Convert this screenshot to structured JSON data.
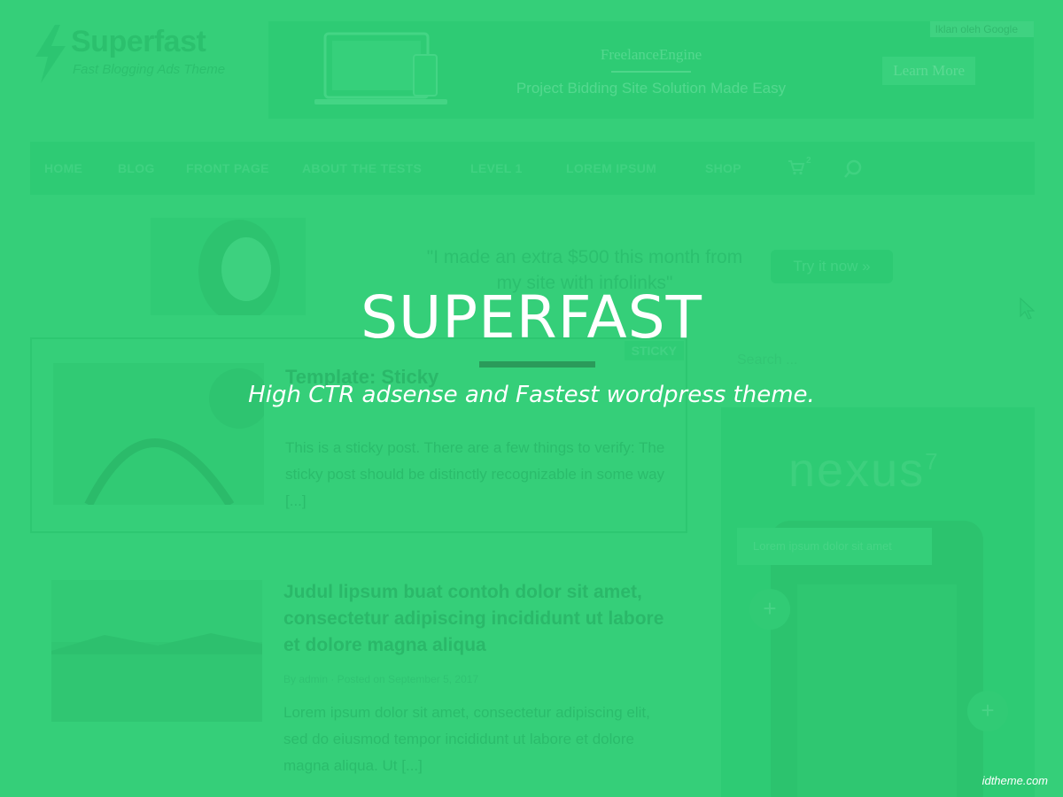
{
  "header": {
    "logo_title": "Superfast",
    "logo_tagline": "Fast Blogging Ads Theme",
    "ad_banner": {
      "label": "Iklan oleh Google",
      "brand": "FreelanceEngine",
      "description": "Project Bidding Site Solution Made Easy",
      "cta": "Learn More"
    }
  },
  "nav": {
    "items": [
      "HOME",
      "BLOG",
      "FRONT PAGE",
      "ABOUT THE TESTS",
      "LEVEL 1",
      "LOREM IPSUM",
      "SHOP"
    ],
    "cart_count": "2"
  },
  "promo": {
    "text": "\"I made an extra $500 this month from my site with infolinks\"",
    "button": "Try it now »"
  },
  "posts": [
    {
      "title": "Template: Sticky",
      "badge": "STICKY",
      "excerpt": "This is a sticky post. There are a few things to verify: The sticky post should be distinctly recognizable in some way [...]"
    },
    {
      "title": "Judul lipsum buat contoh dolor sit amet, consectetur adipiscing incididunt ut labore et dolore magna aliqua",
      "meta": "By admin · Posted on September 5, 2017",
      "excerpt": "Lorem ipsum dolor sit amet, consectetur adipiscing elit, sed do eiusmod tempor incididunt ut labore et dolore magna aliqua. Ut [...]"
    }
  ],
  "sidebar": {
    "search_placeholder": "Search ...",
    "ad_brand": "nexus",
    "ad_brand_sup": "7",
    "ad_pill": "Lorem ipsum dolor sit amet"
  },
  "hero": {
    "title": "SUPERFAST",
    "subtitle": "High CTR adsense and Fastest wordpress theme."
  },
  "watermark": "idtheme.com",
  "colors": {
    "overlay": "#3bd07d",
    "hero_rule": "#2a9b5a",
    "text": "#ffffff"
  }
}
